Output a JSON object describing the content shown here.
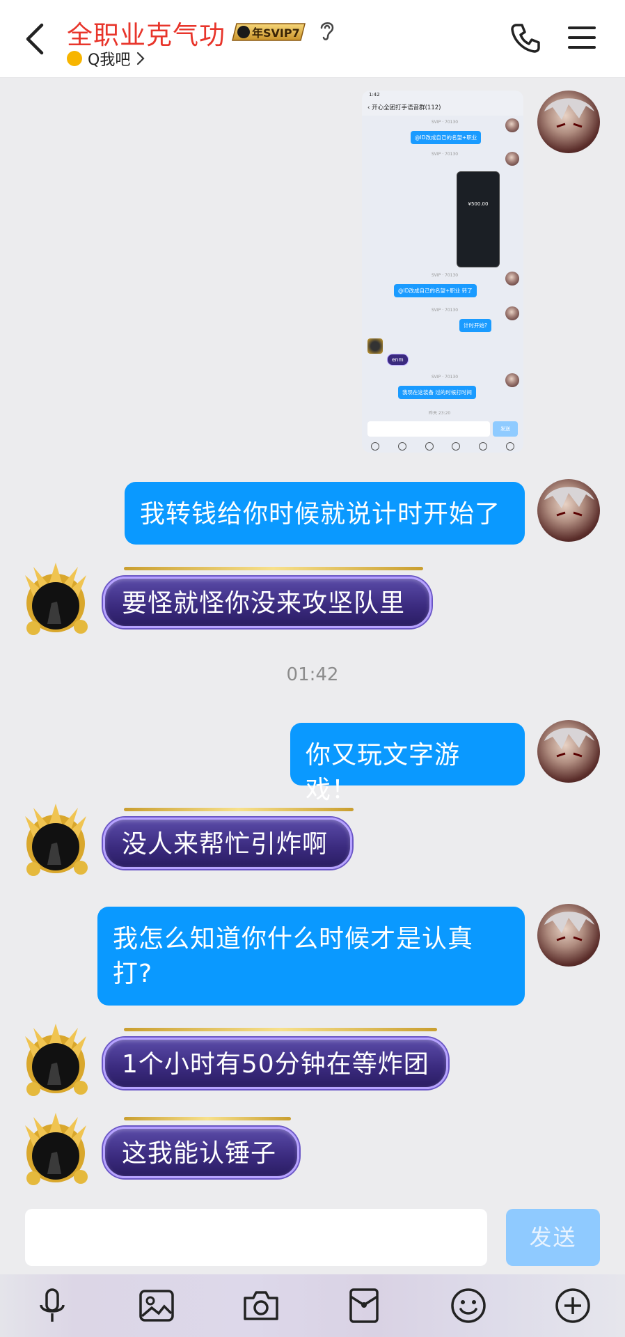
{
  "header": {
    "title": "全职业克气功",
    "badge": "年SVIP7",
    "subtitle": "Q我吧",
    "icons": [
      "back-arrow-icon",
      "svip-badge-icon",
      "ear-icon",
      "phone-icon",
      "menu-icon"
    ]
  },
  "screenshot_msg": {
    "status_time": "1:42",
    "group_title": "开心全团打手语音群(112)",
    "items": [
      {
        "text": "@ID改成自己的名望+职业"
      },
      {
        "text": "¥500.00"
      },
      {
        "text": "@ID改成自己的名望+职业 转了"
      },
      {
        "text": "计时开始?"
      },
      {
        "text": "enm"
      },
      {
        "text": "我现在这装备 过的时候打时间"
      }
    ],
    "meta_time": "昨天 23:20",
    "send_label": "发送"
  },
  "messages": [
    {
      "side": "me",
      "text": "我转钱给你时候就说计时开始了"
    },
    {
      "side": "them",
      "text": "要怪就怪你没来攻坚队里"
    },
    {
      "side": "me",
      "text": "你又玩文字游戏！"
    },
    {
      "side": "them",
      "text": "没人来帮忙引炸啊"
    },
    {
      "side": "me",
      "text": "我怎么知道你什么时候才是认真打?"
    },
    {
      "side": "them",
      "text": "1个小时有50分钟在等炸团"
    },
    {
      "side": "them",
      "text": "这我能认锤子"
    }
  ],
  "timestamp": "01:42",
  "input": {
    "placeholder": "",
    "send_label": "发送"
  },
  "toolbar": {
    "icons": [
      "microphone-icon",
      "image-icon",
      "camera-icon",
      "red-packet-icon",
      "emoji-icon",
      "plus-icon"
    ]
  },
  "colors": {
    "title_red": "#e8352b",
    "bubble_blue": "#0a99ff",
    "bubble_purple": "#3a2a7e",
    "send_disabled": "#8fcaff"
  }
}
